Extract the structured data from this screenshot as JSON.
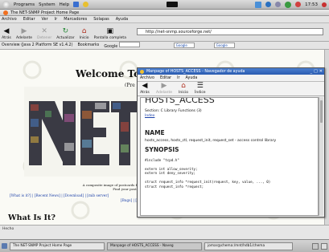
{
  "panel": {
    "menus": [
      "Programs",
      "System",
      "Help"
    ],
    "clock": "17:53"
  },
  "browser": {
    "title": "The NET-SNMP Project Home Page",
    "menu": [
      "Archivo",
      "Editar",
      "Ver",
      "Ir",
      "Marcadores",
      "Solapas",
      "Ayuda"
    ],
    "toolbar": [
      "Atrás",
      "Adelante",
      "Detener",
      "Actualizar",
      "Inicio",
      "Pantalla completa"
    ],
    "url": "http://net-snmp.sourceforge.net/",
    "bookmarks": [
      "Overview (Java 2 Platform SE v1.4.2)",
      "Bookmarks"
    ],
    "google_label": "Google",
    "status_text": "Hecho"
  },
  "page": {
    "heading": "Welcome To T",
    "subheading": "(Pre",
    "logo_text": "NET",
    "caption_lines": [
      "A composite image of postcards fr",
      "Find your postc"
    ],
    "links_line1": "[What is it?] | [Recent News] | [Download] | [mib server]",
    "links_line2": "[Bugs] | [",
    "section_heading": "What Is It?"
  },
  "help": {
    "title": "Manpage of HOSTS_ACCESS - Navegador de ayuda",
    "menu": [
      "Archivo",
      "Editar",
      "Ir",
      "Ayuda"
    ],
    "toolbar": [
      "Atrás",
      "Adelante",
      "Inicio",
      "Índice"
    ],
    "page_title": "HOSTS_ACCESS",
    "section_line": "Section: C Library Functions (3)",
    "index_link": "Index",
    "name_heading": "NAME",
    "name_text": "hosts_access, hosts_ctl, request_init, request_set - access control library",
    "synopsis_heading": "SYNOPSIS",
    "code": "#include \"tcpd.h\"\n\nextern int allow_severity;\nextern int deny_severity;\n\nstruct request_info *request_init(request, key, value, ..., 0)\nstruct request_info *request;"
  },
  "taskbar": {
    "tasks": [
      "The NET-SNMP Project Home Page",
      "Manpage of HOSTS_ACCESS - Naveg",
      "jomar@chema:/mnt/hdb1/chema"
    ]
  }
}
